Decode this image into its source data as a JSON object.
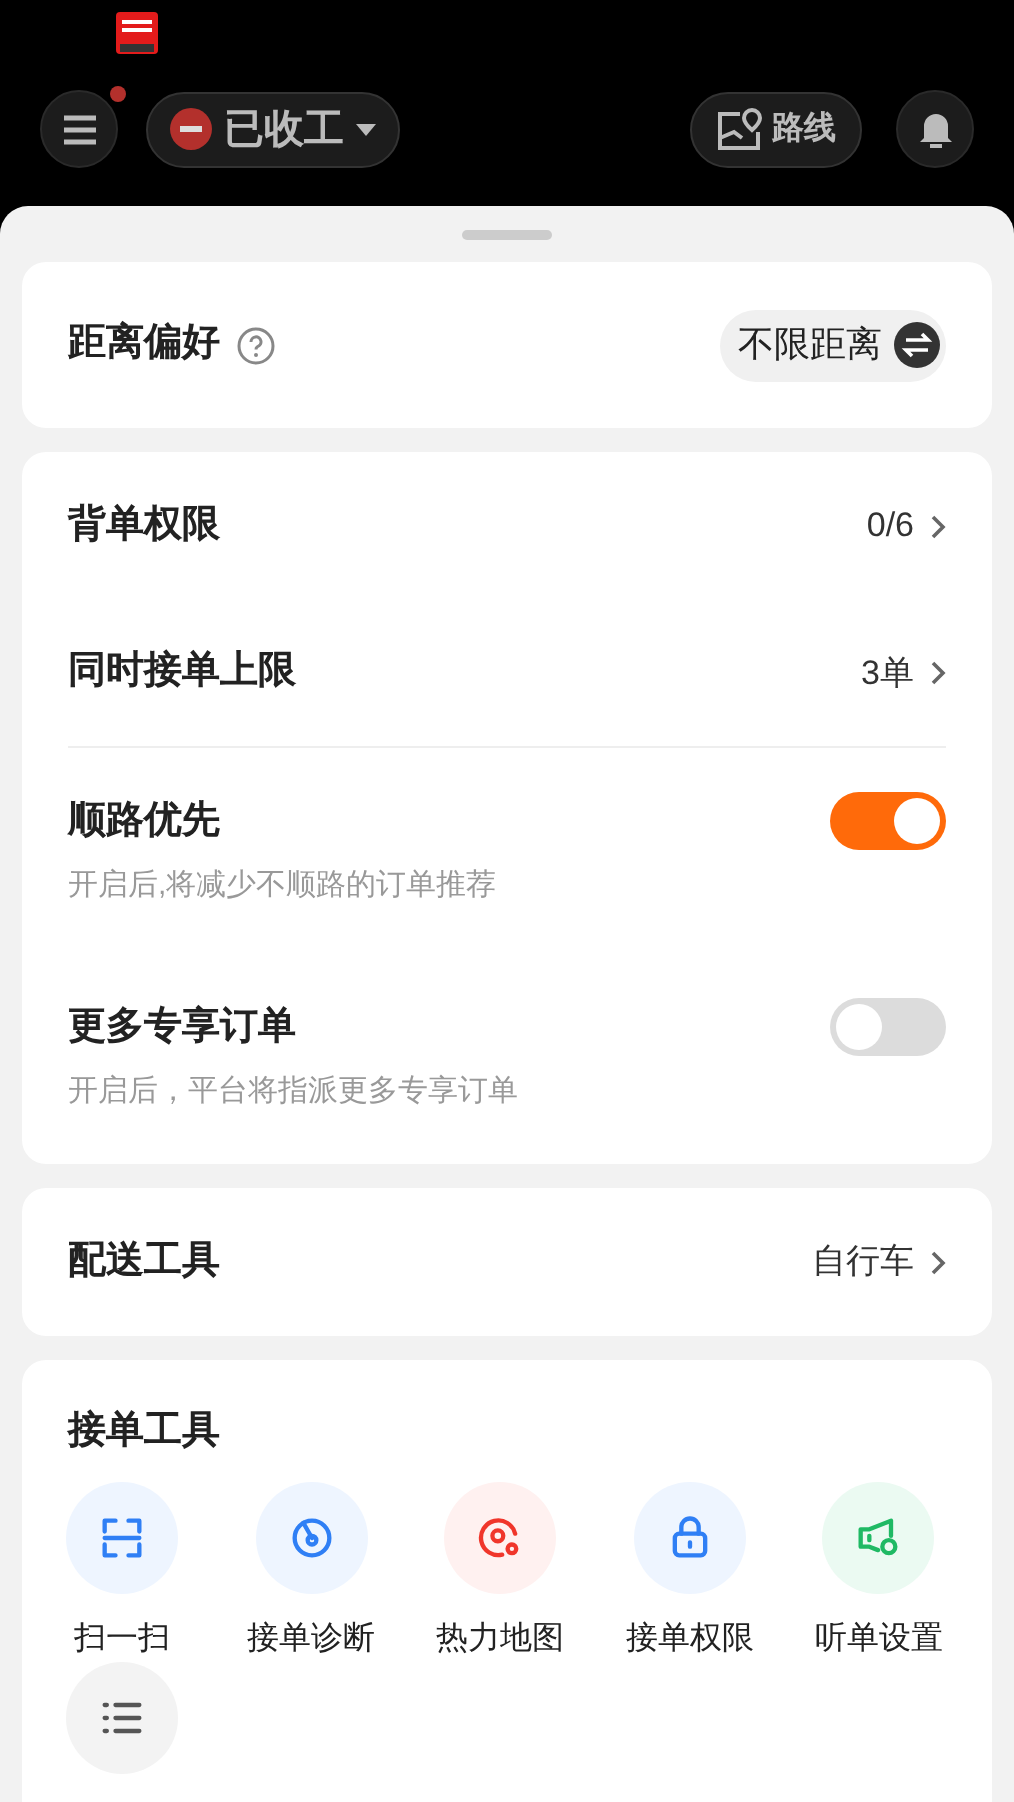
{
  "header": {
    "menu_badge": true,
    "status": "已收工",
    "route": "路线"
  },
  "distance": {
    "label": "距离偏好",
    "value": "不限距离"
  },
  "settings": [
    {
      "kind": "link",
      "label": "背单权限",
      "value": "0/6"
    },
    {
      "kind": "link",
      "label": "同时接单上限",
      "value": "3单"
    },
    {
      "kind": "toggle",
      "label": "顺路优先",
      "hint": "开启后,将减少不顺路的订单推荐",
      "on": true
    },
    {
      "kind": "toggle",
      "label": "更多专享订单",
      "hint": "开启后，平台将指派更多专享订单",
      "on": false
    }
  ],
  "delivery": {
    "label": "配送工具",
    "value": "自行车"
  },
  "tools": {
    "title": "接单工具",
    "items": [
      {
        "kind": "scan",
        "label": "扫一扫"
      },
      {
        "kind": "diagnose",
        "label": "接单诊断"
      },
      {
        "kind": "heatmap",
        "label": "热力地图"
      },
      {
        "kind": "lock",
        "label": "接单权限"
      },
      {
        "kind": "speaker",
        "label": "听单设置"
      },
      {
        "kind": "list"
      }
    ]
  }
}
